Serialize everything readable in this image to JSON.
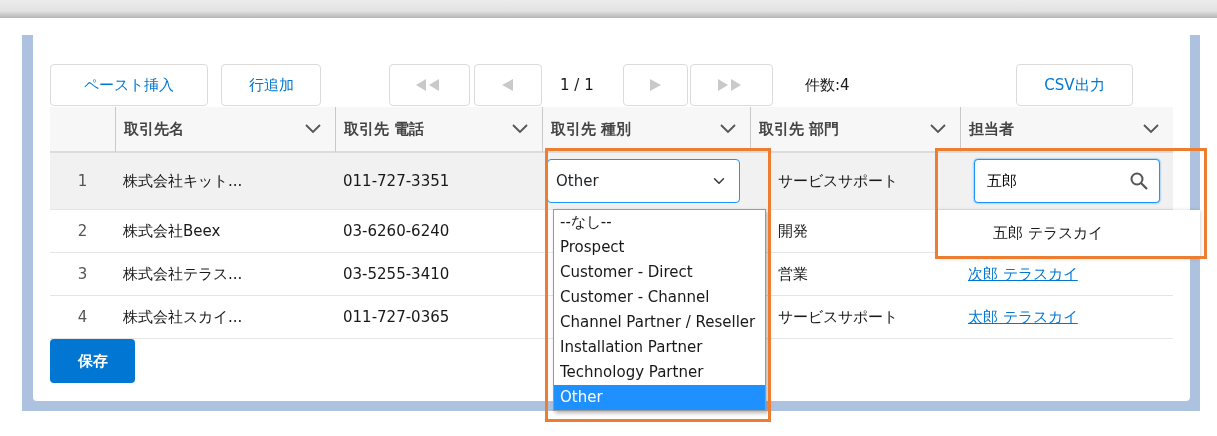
{
  "toolbar": {
    "buttons": [
      {
        "label": "ペースト挿入"
      },
      {
        "label": "行追加"
      }
    ],
    "pager_buttons": [
      {
        "kind": "first",
        "disabled": true
      },
      {
        "kind": "prev",
        "disabled": true
      },
      {
        "kind": "next",
        "disabled": true
      },
      {
        "kind": "last",
        "disabled": true
      }
    ],
    "page_label": "1 / 1",
    "record_count": "件数:4",
    "export_button": "CSV出力"
  },
  "table": {
    "columns": [
      {
        "label": "取引先名"
      },
      {
        "label": "取引先 電話"
      },
      {
        "label": "取引先 種別"
      },
      {
        "label": "取引先 部門"
      },
      {
        "label": "担当者"
      }
    ],
    "rows": [
      {
        "number": "1",
        "name": "株式会社キット...",
        "phone": "011-727-3351",
        "department": "サービスサポート",
        "selected": true,
        "type_editor": {
          "value": "Other",
          "options": [
            {
              "label": "--なし--",
              "selected": false
            },
            {
              "label": "Prospect",
              "selected": false
            },
            {
              "label": "Customer - Direct",
              "selected": false
            },
            {
              "label": "Customer - Channel",
              "selected": false
            },
            {
              "label": "Channel Partner / Reseller",
              "selected": false
            },
            {
              "label": "Installation Partner",
              "selected": false
            },
            {
              "label": "Technology Partner",
              "selected": false
            },
            {
              "label": "Other",
              "selected": true
            }
          ]
        },
        "owner_editor": {
          "value": "五郎",
          "suggestions": [
            "五郎 テラスカイ"
          ]
        }
      },
      {
        "number": "2",
        "name": "株式会社Beex",
        "phone": "03-6260-6240",
        "department": "開発",
        "selected": false
      },
      {
        "number": "3",
        "name": "株式会社テラス...",
        "phone": "03-5255-3410",
        "department": "営業",
        "owner": "次郎 テラスカイ",
        "selected": false
      },
      {
        "number": "4",
        "name": "株式会社スカイ...",
        "phone": "011-727-0365",
        "department": "サービスサポート",
        "owner": "太郎 テラスカイ",
        "selected": false
      }
    ]
  },
  "save_button": "保存"
}
